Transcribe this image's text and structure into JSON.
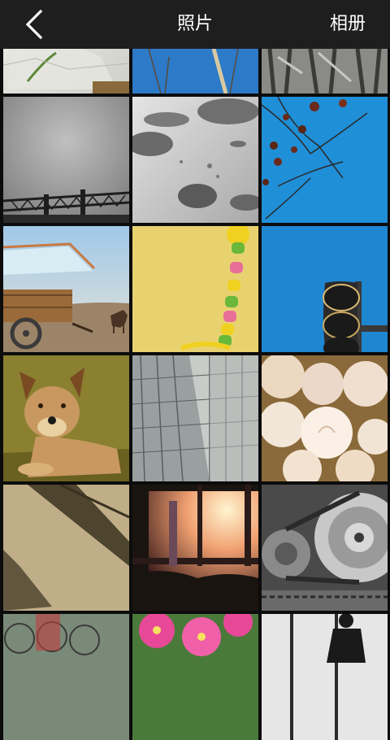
{
  "header": {
    "title": "照片",
    "albums_label": "相册",
    "back_icon": "chevron-left-icon"
  },
  "photos": [
    {
      "subject": "glass-cup"
    },
    {
      "subject": "bare-branches"
    },
    {
      "subject": "tree-bark"
    },
    {
      "subject": "crane-structure"
    },
    {
      "subject": "water-drops"
    },
    {
      "subject": "persimmon-branch"
    },
    {
      "subject": "cart-and-horse"
    },
    {
      "subject": "bead-toy"
    },
    {
      "subject": "traffic-light"
    },
    {
      "subject": "dog-on-grass"
    },
    {
      "subject": "glass-building"
    },
    {
      "subject": "white-roses"
    },
    {
      "subject": "wall-shadow"
    },
    {
      "subject": "sunset-window"
    },
    {
      "subject": "machine-gears"
    },
    {
      "subject": "bicycles"
    },
    {
      "subject": "pink-flowers"
    },
    {
      "subject": "silhouette-figure"
    }
  ]
}
